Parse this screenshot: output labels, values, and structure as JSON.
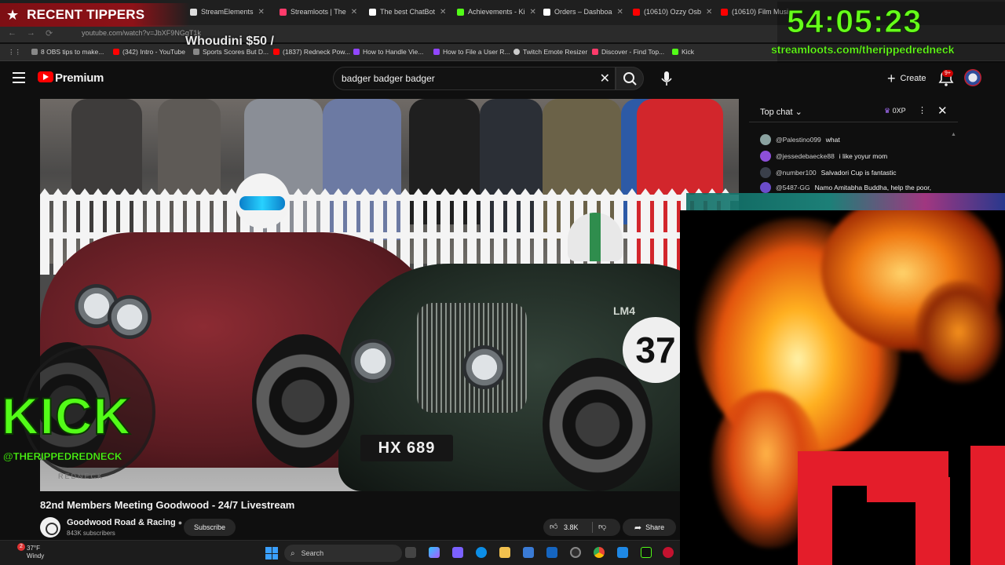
{
  "browser": {
    "tabs": [
      {
        "label": "StreamElements",
        "color": "#ffffff"
      },
      {
        "label": "Streamloots | The",
        "color": "#ff3b6b"
      },
      {
        "label": "The best ChatBot",
        "color": "#ffffff"
      },
      {
        "label": "Achievements - Ki",
        "color": "#53fc18"
      },
      {
        "label": "Orders – Dashboa",
        "color": "#ffffff"
      },
      {
        "label": "(10610) Ozzy Osb",
        "color": "#ff0000"
      },
      {
        "label": "(10610) Film Musi",
        "color": "#ff0000"
      }
    ],
    "url": "youtube.com/watch?v=JbXF9NGgT1k",
    "bookmarks": [
      {
        "label": "8 OBS tips to make...",
        "color": "#888888"
      },
      {
        "label": "(342) Intro - YouTube",
        "color": "#ff0000"
      },
      {
        "label": "Sports Scores But D...",
        "color": "#888888"
      },
      {
        "label": "(1837) Redneck Pow...",
        "color": "#ff0000"
      },
      {
        "label": "How to Handle Vie...",
        "color": "#9146ff"
      },
      {
        "label": "How to File a User R...",
        "color": "#9146ff"
      },
      {
        "label": "Twitch Emote Resizer",
        "color": "#cccccc"
      },
      {
        "label": "Discover - Find Top...",
        "color": "#ff3b6b"
      },
      {
        "label": "Kick",
        "color": "#53fc18"
      }
    ]
  },
  "overlay": {
    "tippers_title": "RECENT TIPPERS",
    "tipper_entry": "Whoudini $50 /",
    "timer": "54:05:23",
    "streamloots_link": "streamloots.com/therippedredneck",
    "kick_word": "KICK",
    "kick_handle": "@THERIPPEDREDNECK",
    "kick_sub": "REDNECK"
  },
  "youtube": {
    "brand": "Premium",
    "search_query": "badger badger badger",
    "create_label": "Create",
    "notif_count": "9+",
    "video": {
      "title": "82nd Members Meeting Goodwood - 24/7 Livestream",
      "plate": "HX 689",
      "car_number": "37",
      "car_marking": "LM4"
    },
    "channel": {
      "name": "Goodwood Road & Racing",
      "subs": "843K subscribers",
      "subscribe_label": "Subscribe"
    },
    "likes": "3.8K",
    "share_label": "Share"
  },
  "chat": {
    "mode": "Top chat",
    "xp": "0XP",
    "messages": [
      {
        "author": "@Palestino099",
        "text": "what",
        "color": "#8aa2a0"
      },
      {
        "author": "@jessedebaecke88",
        "text": "i like yoyur mom",
        "color": "#8d4fd8"
      },
      {
        "author": "@number100",
        "text": "Salvadori Cup is fantastic",
        "color": "#3a3f4a"
      },
      {
        "author": "@5487-GG",
        "text": "Namo Amitabha Buddha, help the poor,",
        "color": "#6b4cc9"
      }
    ]
  },
  "taskbar": {
    "temp": "37°F",
    "weather": "Windy",
    "weather_badge": "2",
    "search_label": "Search"
  },
  "colors": {
    "tippers_bg": "#8e1218",
    "timer_green": "#66ff1a",
    "kick_green": "#53fc18",
    "yt_red": "#ff0000",
    "fire_red": "#e41d2a"
  }
}
